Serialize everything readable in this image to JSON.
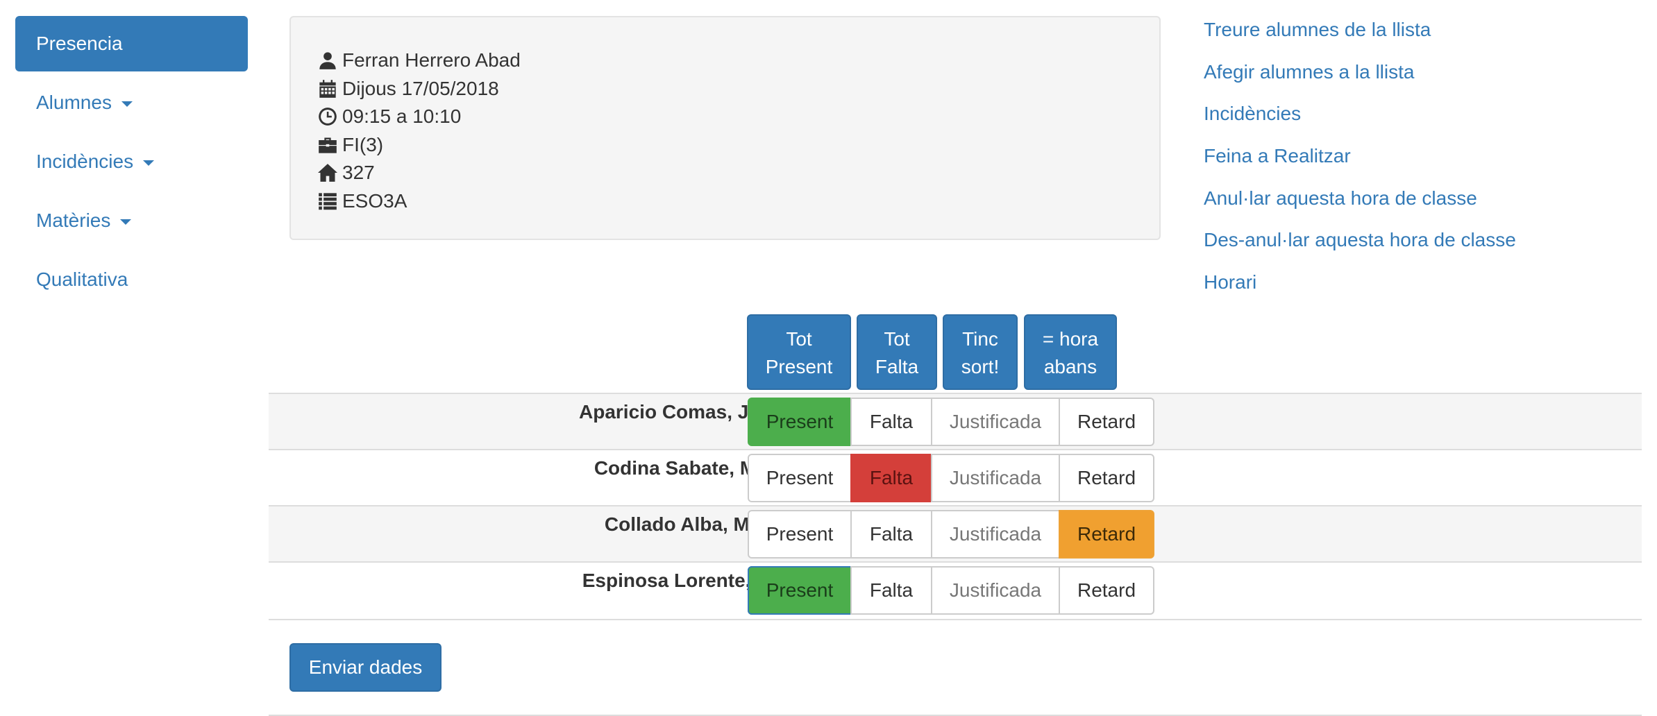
{
  "sidebar": {
    "items": [
      {
        "label": "Presencia"
      },
      {
        "label": "Alumnes"
      },
      {
        "label": "Incidències"
      },
      {
        "label": "Matèries"
      },
      {
        "label": "Qualitativa"
      }
    ]
  },
  "info": {
    "teacher": "Ferran Herrero Abad",
    "date": "Dijous 17/05/2018",
    "time": "09:15 a 10:10",
    "subject": "FI(3)",
    "room": "327",
    "group": "ESO3A"
  },
  "links": [
    "Treure alumnes de la llista",
    "Afegir alumnes a la llista",
    "Incidències",
    "Feina a Realitzar",
    "Anul·lar aquesta hora de classe",
    "Des-anul·lar aquesta hora de classe",
    "Horari"
  ],
  "actions": {
    "all_present": [
      "Tot",
      "Present"
    ],
    "all_absent": [
      "Tot",
      "Falta"
    ],
    "going_out": [
      "Tinc",
      "sort!"
    ],
    "same_as_before": [
      "= hora",
      "abans"
    ]
  },
  "options": {
    "present": "Present",
    "absent": "Falta",
    "justified": "Justificada",
    "late": "Retard"
  },
  "students": [
    {
      "name": "Aparicio Comas, Joana:",
      "status": "present"
    },
    {
      "name": "Codina Sabate, Malak:",
      "status": "absent"
    },
    {
      "name": "Collado Alba, Marwa:",
      "status": "late"
    },
    {
      "name": "Espinosa Lorente, Izan:",
      "status": "present"
    }
  ],
  "submit_label": "Enviar dades",
  "colors": {
    "primary": "#337ab7",
    "present": "#4cae4c",
    "absent": "#d43f3a",
    "late": "#f0a030"
  }
}
